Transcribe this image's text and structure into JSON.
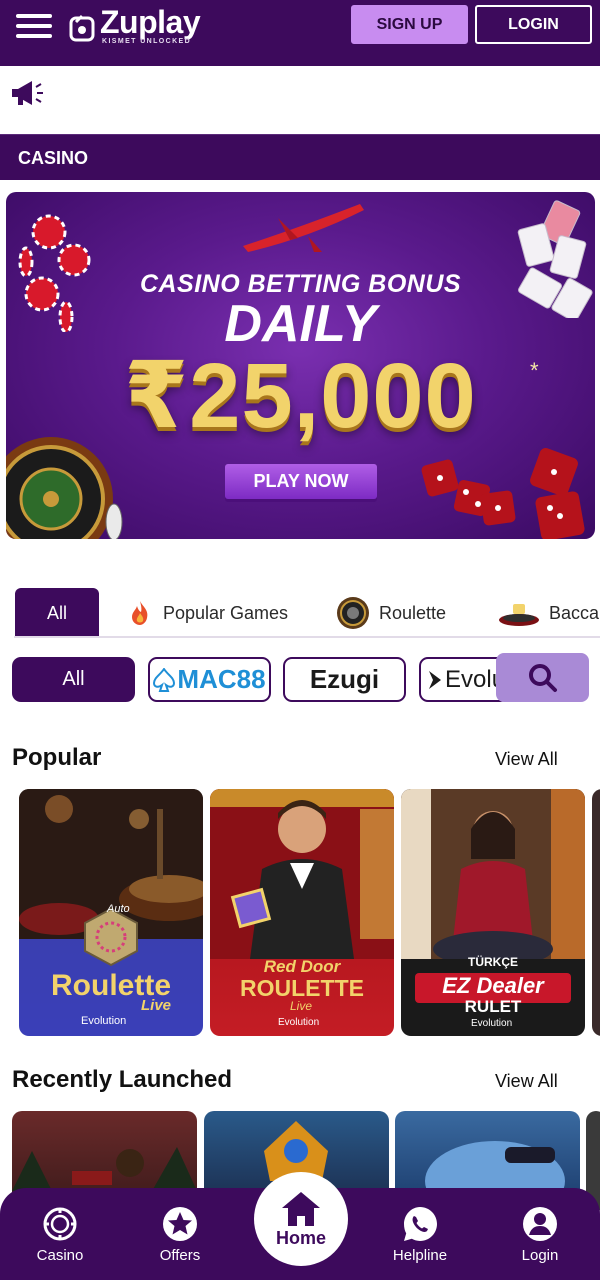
{
  "header": {
    "menu_icon": "hamburger-menu-icon",
    "logo_text": "Zuplay",
    "logo_tagline": "KISMET UNLOCKED",
    "signup_label": "SIGN UP",
    "login_label": "LOGIN"
  },
  "announcement": {
    "icon": "megaphone-icon"
  },
  "section_title": "CASINO",
  "banner": {
    "line1": "CASINO BETTING BONUS",
    "line2": "DAILY",
    "amount": "₹25,000",
    "asterisk": "*",
    "cta": "PLAY NOW"
  },
  "category_tabs": [
    {
      "label": "All",
      "active": true
    },
    {
      "label": "Popular Games",
      "icon": "fire-icon"
    },
    {
      "label": "Roulette",
      "icon": "roulette-wheel-icon"
    },
    {
      "label": "Bacca",
      "icon": "baccarat-table-icon"
    }
  ],
  "providers": [
    {
      "label": "All",
      "active": true
    },
    {
      "label": "MAC88"
    },
    {
      "label": "Ezugi"
    },
    {
      "label": "Evolu"
    }
  ],
  "search_icon": "search-icon",
  "popular": {
    "title": "Popular",
    "view_all": "View All",
    "cards": [
      {
        "title": "Roulette",
        "subtitle": "Live",
        "badge": "Auto",
        "provider": "Evolution"
      },
      {
        "title": "Red Door",
        "title2": "ROULETTE",
        "subtitle": "Live",
        "provider": "Evolution"
      },
      {
        "title": "EZ Dealer",
        "title2": "RULET",
        "badge": "TÜRKÇE",
        "provider": "Evolution"
      }
    ]
  },
  "recently_launched": {
    "title": "Recently Launched",
    "view_all": "View All"
  },
  "bottom_nav": {
    "casino": "Casino",
    "offers": "Offers",
    "home": "Home",
    "helpline": "Helpline",
    "login": "Login"
  },
  "colors": {
    "brand_purple": "#3d0a5c",
    "signup_bg": "#c88cf0",
    "search_bg": "#a98ad6",
    "banner_gold": "#f2d36b"
  }
}
